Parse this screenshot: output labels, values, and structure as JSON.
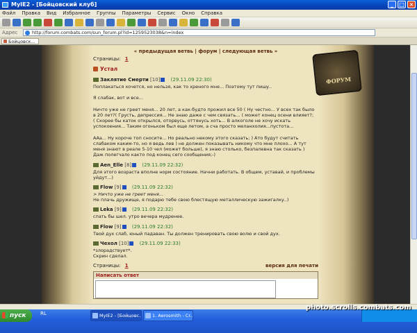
{
  "window": {
    "title": "MyIE2 - [Бойцовский клуб]"
  },
  "menu": [
    "Файл",
    "Правка",
    "Вид",
    "Избранное",
    "Группы",
    "Параметры",
    "Сервис",
    "Окно",
    "Справка"
  ],
  "address": {
    "label": "Адрес",
    "url": "http://forum.combats.com/sun_forum.pl?id=1259523038&n=index"
  },
  "tab": {
    "label": "Бойцовск..."
  },
  "nav": {
    "prev": "« предыдущая ветвь",
    "forum": "форум",
    "next": "следующая ветвь »",
    "sep": "|"
  },
  "pages_label": "Страницы:",
  "page_number": "1",
  "topic_title": "Устал",
  "posts": [
    {
      "nick": "Заклятие Смерти",
      "level": "[10]",
      "date": "(29.11.09 22:30)",
      "text": "Поплакаться хочется, но нельзя, как то хреного мне... Поэтому тут пишу..\n\nЯ слабак, вот и все...\n\nНичто уже не греет меня... 20 лет, а как-будто прожил все 50 ( Ну честно... У всех так было в 20 лет?( Грусть, депрессия... Не знаю даже с чем связать... ( может конец осени влияет?; ( Скорее бы каток открылся, оторвусь, оттянусь хоть... В алкоголе не хочу искать успокоения... Таким огоньком был еще летом, а сча просто меланхолия...пустота...\n\nААа... Ну короче топ сносите... Но реально некому этого сказать; ) Ато будут считать слабаком каким-то, но я ведь лев ) не должен показывать никому что мне плохо... А тут меня знают в реале 5-10 чел (может больше), я знаю столько, безпалевна так сказать ) Даж полегчало както под конец сего сообщения;-)"
    },
    {
      "nick": "Aen_Elle",
      "level": "[8]",
      "date": "(29.11.09 22:32)",
      "text": "Для этого возраста вполне норм состояние. Начни работать. В общем, уставай, и проблемы уйдут...)"
    },
    {
      "nick": "Flow",
      "level": "[9]",
      "date": "(29.11.09 22:32)",
      "quote": "> Ничто уже не греет меня...",
      "text": "Не плачь дружище, я подарю тебе свою блестящую металлическую зажигалку..)"
    },
    {
      "nick": "Leka",
      "level": "[9]",
      "date": "(29.11.09 22:32)",
      "text": "спать бы шел. утро вечера мудренее."
    },
    {
      "nick": "Flow",
      "level": "[9]",
      "date": "(29.11.09 22:32)",
      "text": "Твой дух слаб, юный падаван. Ты должен тренировать свою волю и свой дух."
    },
    {
      "nick": "Чехол",
      "level": "[10]",
      "date": "(29.11.09 22:33)",
      "text": "*злорадствует*.\nСкрин сделал."
    }
  ],
  "print_version": "версия для печати",
  "reply_title": "Написать ответ",
  "logo_text": "ФОРУМ",
  "taskbar": {
    "start": "пуск",
    "quicklaunch": "RL",
    "tasks": [
      "MyIE2 - [Бойцовс...",
      "1. Aerosmith - Cr..."
    ]
  },
  "watermark": "photo.scrolls.combats.com"
}
